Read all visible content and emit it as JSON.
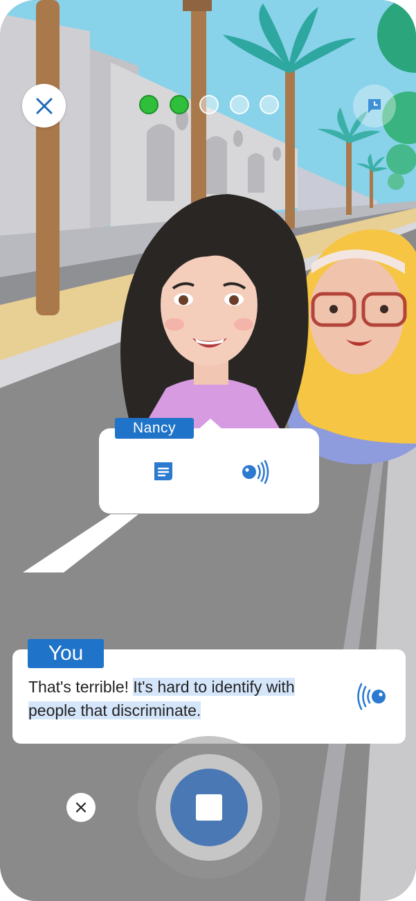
{
  "header": {
    "close_icon": "close-icon",
    "hint_icon": "chat-clock-icon",
    "progress": {
      "completed": 2,
      "total": 5
    }
  },
  "conversation": {
    "partner": {
      "name": "Nancy",
      "actions": {
        "text_icon": "message-text-icon",
        "audio_icon": "speaker-icon"
      }
    },
    "user": {
      "label": "You",
      "text_plain": "That's terrible! ",
      "text_highlighted": "It's hard to identify with people that discriminate.",
      "audio_icon": "speaker-icon"
    }
  },
  "controls": {
    "cancel_icon": "close-icon",
    "stop_icon": "stop-icon"
  },
  "colors": {
    "accent": "#1f73c8",
    "progress_done": "#2fbf3a",
    "highlight": "#d5e6fb",
    "stop_button": "#4a78b5"
  }
}
